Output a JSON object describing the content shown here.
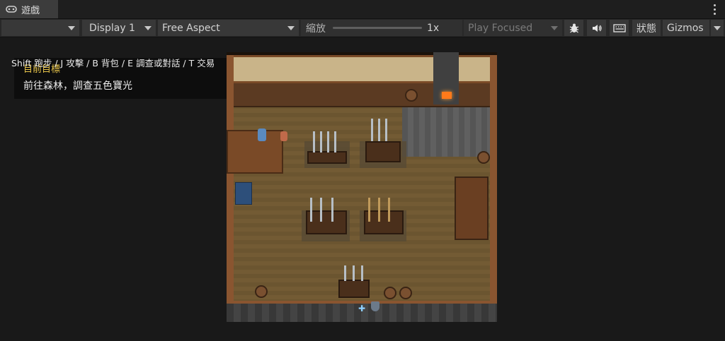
{
  "tab": {
    "label": "遊戲",
    "icon": "gamepad-icon"
  },
  "toolbar": {
    "display": "Display 1",
    "aspect": "Free Aspect",
    "scale_label": "縮放",
    "scale_value": "1x",
    "play_mode": "Play Focused",
    "stats": "狀態",
    "gizmos": "Gizmos"
  },
  "hud": {
    "hint": "Shift 跑步 / J 攻擊 / B 背包 / E 調查或對話 / T 交易",
    "objective_title": "目前目標",
    "objective_text": "前往森林，調查五色寶光"
  }
}
